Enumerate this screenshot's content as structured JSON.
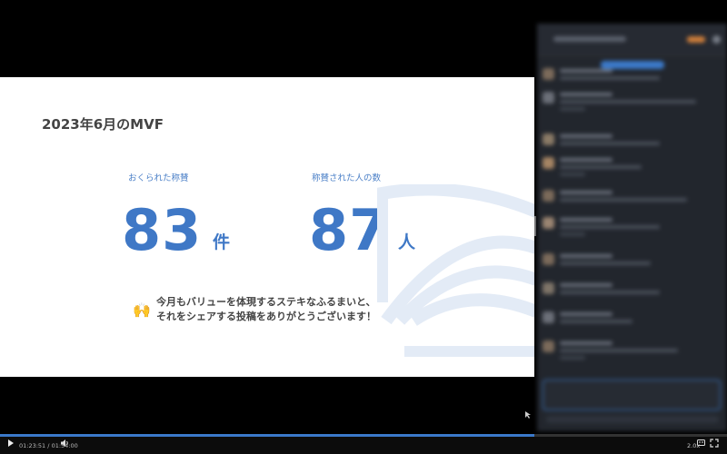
{
  "slide": {
    "title": "2023年6月のMVF",
    "stats": [
      {
        "label": "おくられた称賛",
        "value": "83",
        "unit": "件"
      },
      {
        "label": "称賛された人の数",
        "value": "87",
        "unit": "人"
      }
    ],
    "message": {
      "emoji": "🙌",
      "line1": "今月もバリューを体現するステキなふるまいと、",
      "line2": "それをシェアする投稿をありがとうございます！"
    }
  },
  "player": {
    "current_time": "01:23:51",
    "separator": "/",
    "duration": "01:54:00",
    "progress": 0.735,
    "speed": "2.0x"
  },
  "colors": {
    "accent": "#3f78c6",
    "title_text": "#444444",
    "chat_bg": "#22262d",
    "progress_fill": "#3b79c9"
  },
  "icons": [
    "play-icon",
    "volume-icon",
    "captions-icon",
    "fullscreen-icon",
    "raised-hands-icon",
    "cursor-icon"
  ]
}
